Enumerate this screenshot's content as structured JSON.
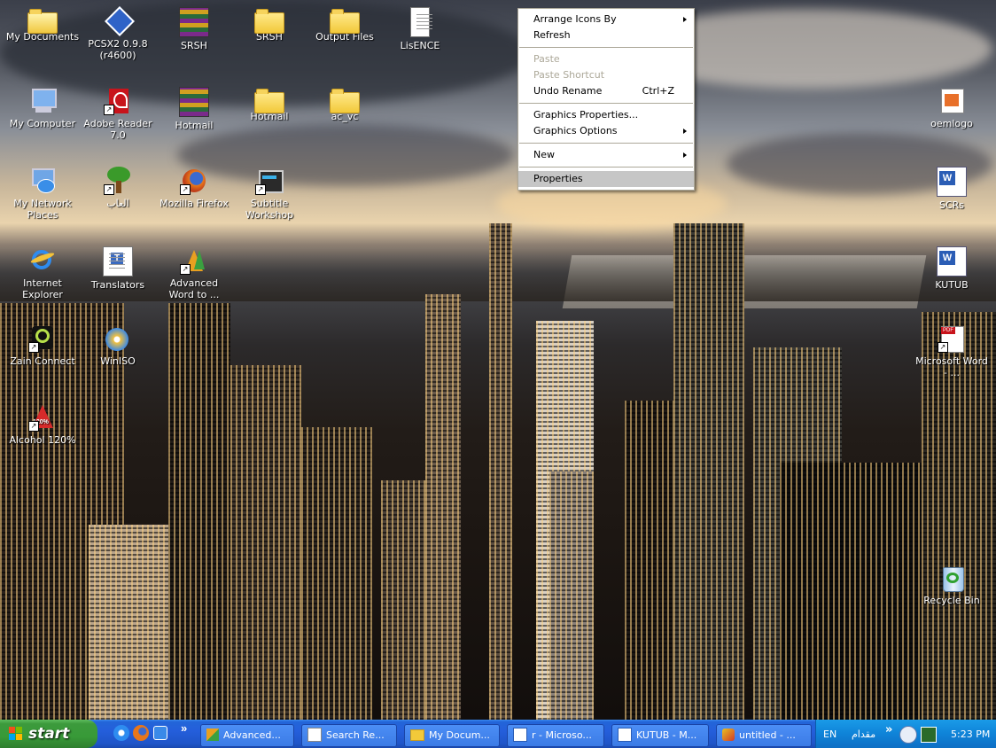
{
  "desktop": {
    "icons": {
      "my_documents": "My Documents",
      "pcsx2_l1": "PCSX2 0.9.8",
      "pcsx2_l2": "(r4600)",
      "srsh_rar": "SRSH",
      "srsh_folder": "SRSH",
      "output_files": "Output Files",
      "lisence": "LisENCE",
      "my_computer": "My Computer",
      "adobe_l1": "Adobe Reader",
      "adobe_l2": "7.0",
      "hotmail_rar": "Hotmail",
      "hotmail_folder": "Hotmail",
      "ac_vc": "ac_vc",
      "network_l1": "My Network",
      "network_l2": "Places",
      "games_ar": "العاب",
      "firefox": "Mozilla Firefox",
      "subtitle_l1": "Subtitle",
      "subtitle_l2": "Workshop",
      "ie_l1": "Internet",
      "ie_l2": "Explorer",
      "translators": "Translators",
      "advword_l1": "Advanced",
      "advword_l2": "Word to ...",
      "zain": "Zain Connect",
      "winiso": "WinISO",
      "alcohol": "Alcohol 120%",
      "oemlogo": "oemlogo",
      "scrs": "SCRs",
      "kutub": "KUTUB",
      "msword_l1": "Microsoft Word",
      "msword_l2": "- ...",
      "recycle": "Recycle Bin",
      "alcohol_badge": "120%",
      "pdf_badge": "PDF"
    }
  },
  "context_menu": {
    "items": [
      {
        "label": "Arrange Icons By",
        "submenu": true
      },
      {
        "label": "Refresh"
      },
      {
        "label": "Paste",
        "disabled": true
      },
      {
        "label": "Paste Shortcut",
        "disabled": true
      },
      {
        "label": "Undo Rename",
        "shortcut": "Ctrl+Z"
      },
      {
        "label": "Graphics Properties..."
      },
      {
        "label": "Graphics Options",
        "submenu": true
      },
      {
        "label": "New",
        "submenu": true
      },
      {
        "label": "Properties",
        "highlighted": true
      }
    ]
  },
  "taskbar": {
    "start_label": "start",
    "buttons": [
      {
        "label": "Advanced...",
        "icon": "advanced-word-icon"
      },
      {
        "label": "Search Re...",
        "icon": "search-icon"
      },
      {
        "label": "My Docum...",
        "icon": "folder-icon"
      },
      {
        "label": "r - Microso...",
        "icon": "word-icon"
      },
      {
        "label": "KUTUB - M...",
        "icon": "word-icon"
      },
      {
        "label": "untitled - ...",
        "icon": "paint-icon"
      }
    ],
    "overflow_chevron": "»",
    "tray": {
      "language": "EN",
      "arabic_text": "مقدام",
      "chevron": "»",
      "clock": "5:23 PM"
    }
  },
  "colors": {
    "taskbar_blue": "#245edb",
    "start_green": "#3c9a3c",
    "tray_blue": "#0f83d8",
    "menu_highlight": "#c6c6c6"
  }
}
